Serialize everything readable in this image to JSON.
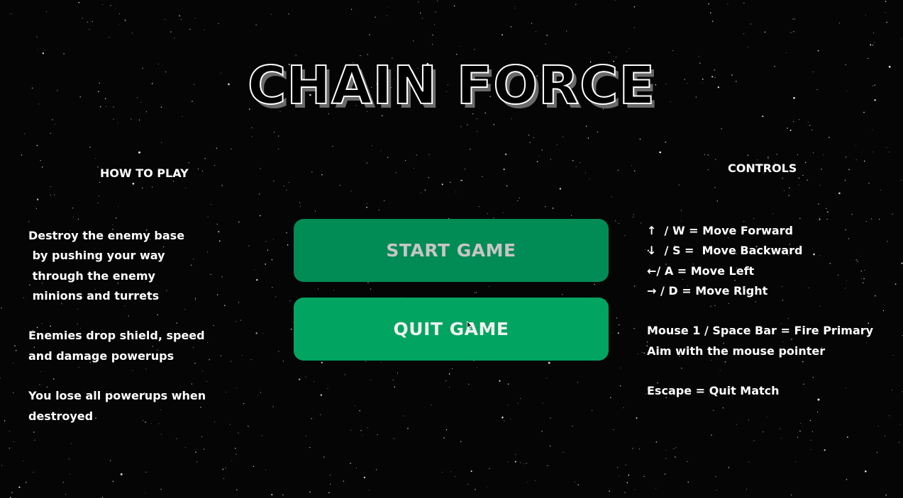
{
  "game": {
    "title": "CHAIN FORCE"
  },
  "how_to_play": {
    "heading": "HOW TO PLAY",
    "paragraphs": [
      [
        "Destroy the enemy base",
        " by pushing your way",
        " through the enemy",
        " minions and turrets"
      ],
      [
        "Enemies drop shield, speed",
        "and damage powerups"
      ],
      [
        "You lose all powerups when",
        "destroyed"
      ]
    ]
  },
  "controls": {
    "heading": "CONTROLS",
    "groups": [
      [
        "↑  / W = Move Forward",
        "↓  / S =  Move Backward",
        "←/ A = Move Left",
        "→ / D = Move Right"
      ],
      [
        "Mouse 1 / Space Bar = Fire Primary",
        "Aim with the mouse pointer"
      ],
      [
        "Escape = Quit Match"
      ]
    ]
  },
  "menu": {
    "start_label": "START GAME",
    "quit_label": "QUIT GAME"
  },
  "colors": {
    "start_button": "#018b55",
    "quit_button": "#01a461",
    "background": "#050505"
  }
}
